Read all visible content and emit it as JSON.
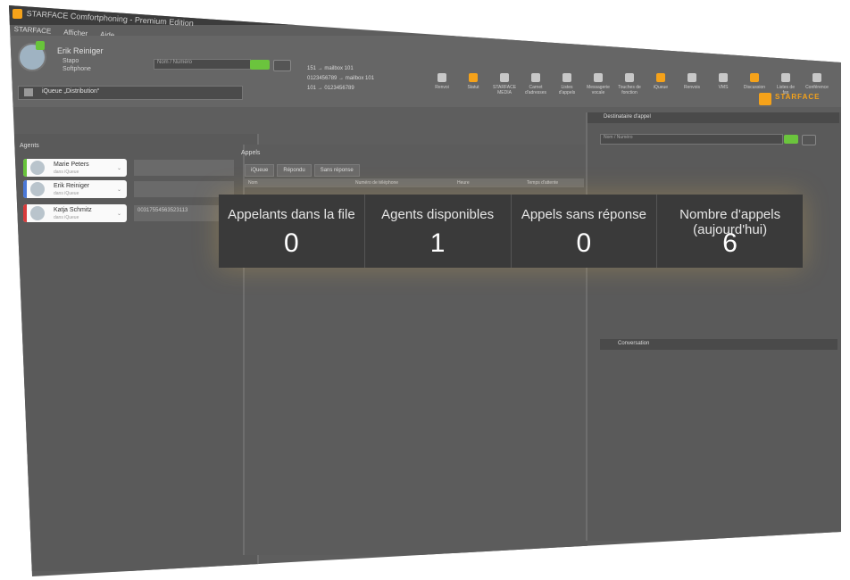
{
  "window": {
    "title": "STARFACE Comfortphoning - Premium Edition",
    "menu": [
      "STARFACE",
      "Afficher",
      "Aide"
    ]
  },
  "user": {
    "name": "Erik Reiniger",
    "lines": [
      "Stapo",
      "Softphone"
    ],
    "search_placeholder": "Nom / Numéro"
  },
  "history": [
    "151 → mailbox 101",
    "0123456789 → mailbox 101",
    "101 → 0123456789"
  ],
  "toolbar": [
    {
      "label": "Renvoi",
      "icon": "phone-icon"
    },
    {
      "label": "Statut",
      "icon": "toggle-icon"
    },
    {
      "label": "STARFACE MEDIA",
      "icon": "camera-icon"
    },
    {
      "label": "Carnet d'adresses",
      "icon": "book-icon"
    },
    {
      "label": "Listes d'appels",
      "icon": "list-icon"
    },
    {
      "label": "Messagerie vocale",
      "icon": "voicemail-icon"
    },
    {
      "label": "Touches de fonction",
      "icon": "keys-icon"
    },
    {
      "label": "iQueue",
      "icon": "queue-icon"
    },
    {
      "label": "Renvois",
      "icon": "forward-icon"
    },
    {
      "label": "VMS",
      "icon": "vm-icon"
    },
    {
      "label": "Discussion",
      "icon": "chat-icon"
    },
    {
      "label": "Listes de fax",
      "icon": "fax-icon"
    },
    {
      "label": "Conférence",
      "icon": "conference-icon"
    }
  ],
  "brand": {
    "name": "STARFACE"
  },
  "queue_tab": {
    "label": "iQueue „Distribution“"
  },
  "agents": {
    "title": "Agents",
    "items": [
      {
        "name": "Marie Peters",
        "sub": "dans iQueue",
        "color": "#68c43a",
        "extra": ""
      },
      {
        "name": "Erik Reiniger",
        "sub": "dans iQueue",
        "color": "#4a78d8",
        "extra": ""
      },
      {
        "name": "Katja Schmitz",
        "sub": "dans iQueue",
        "color": "#d83a3a",
        "extra": "00317554563523113"
      }
    ]
  },
  "calls": {
    "title": "Appels",
    "tabs": [
      "iQueue",
      "Répondu",
      "Sans réponse"
    ],
    "columns": [
      "Nom",
      "Numéro de téléphone",
      "Heure",
      "Temps d'attente"
    ]
  },
  "right_panel": {
    "header": "Destinataire d'appel",
    "search_placeholder": "Nom / Numéro",
    "conversation": "Conversation"
  },
  "stats": [
    {
      "label": "Appelants dans la file",
      "value": "0"
    },
    {
      "label": "Agents disponibles",
      "value": "1"
    },
    {
      "label": "Appels sans réponse",
      "value": "0"
    },
    {
      "label": "Nombre d'appels (aujourd'hui)",
      "value": "6"
    }
  ]
}
